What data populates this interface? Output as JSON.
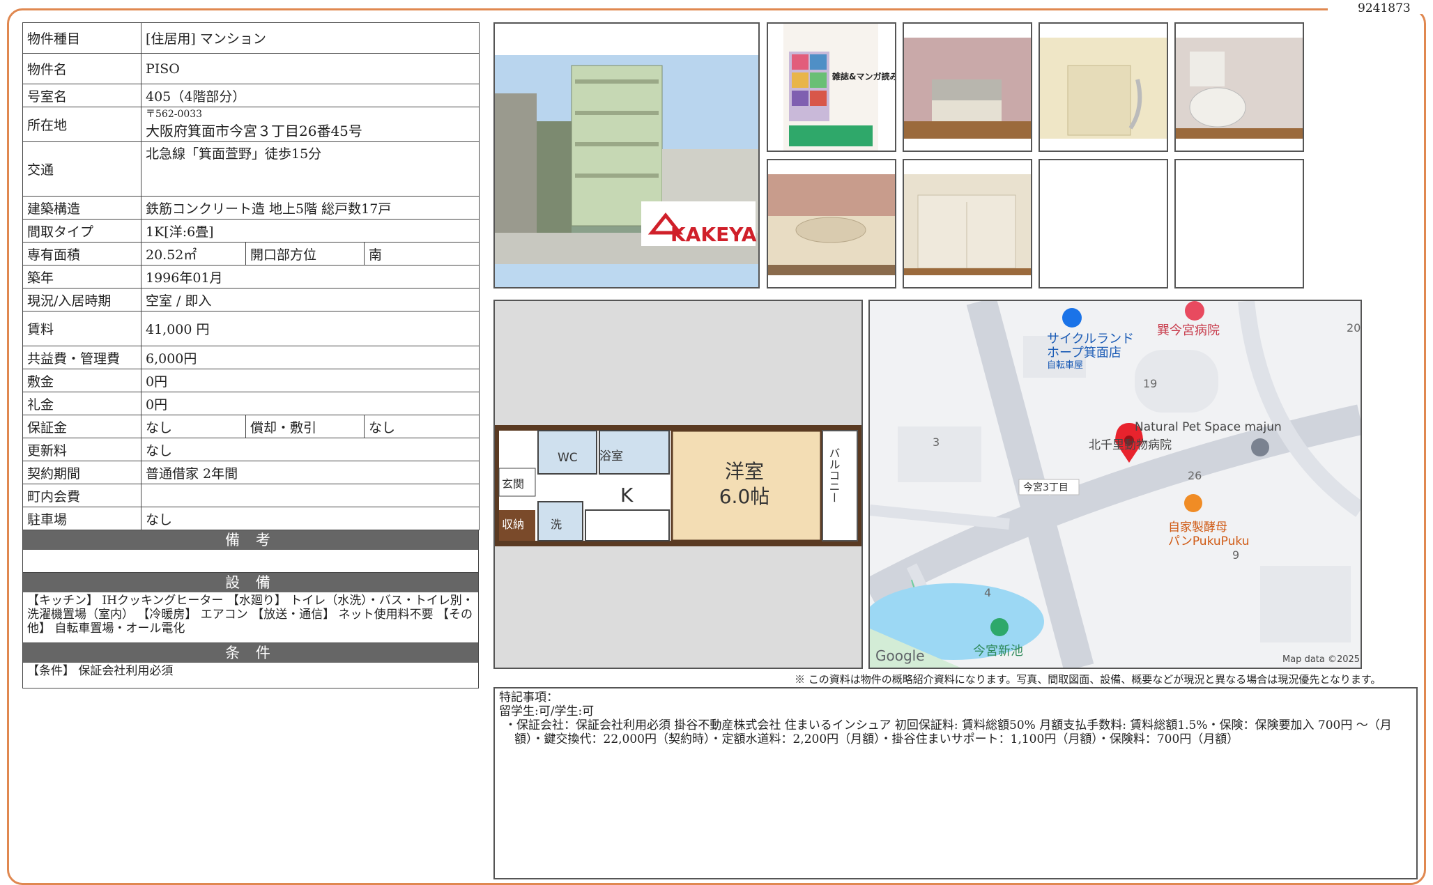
{
  "doc_id": "9241873",
  "property": {
    "type_label": "物件種目",
    "type_value": "[住居用] マンション",
    "name_label": "物件名",
    "name_value": "PISO",
    "room_label": "号室名",
    "room_value": "405（4階部分）",
    "address_label": "所在地",
    "postal": "〒562-0033",
    "address_value": "大阪府箕面市今宮３丁目26番45号",
    "transit_label": "交通",
    "transit_value": "北急線「箕面萱野」徒歩15分",
    "structure_label": "建築構造",
    "structure_value": "鉄筋コンクリート造 地上5階 総戸数17戸",
    "layout_label": "間取タイプ",
    "layout_value": "1K[洋:6畳]",
    "area_label": "専有面積",
    "area_value": "20.52㎡",
    "direction_label": "開口部方位",
    "direction_value": "南",
    "built_label": "築年",
    "built_value": "1996年01月",
    "status_label": "現況/入居時期",
    "status_value": "空室 / 即入",
    "rent_label": "賃料",
    "rent_value": "41,000 円",
    "fee_label": "共益費・管理費",
    "fee_value": "6,000円",
    "deposit_label": "敷金",
    "deposit_value": "0円",
    "key_money_label": "礼金",
    "key_money_value": "0円",
    "guarantee_label": "保証金",
    "guarantee_value": "なし",
    "amortization_label": "償却・敷引",
    "amortization_value": "なし",
    "renewal_label": "更新料",
    "renewal_value": "なし",
    "contract_label": "契約期間",
    "contract_value": "普通借家 2年間",
    "association_label": "町内会費",
    "association_value": "",
    "parking_label": "駐車場",
    "parking_value": "なし"
  },
  "sections": {
    "remarks_title": "備 考",
    "remarks_body": "",
    "equipment_title": "設 備",
    "equipment_body": "【キッチン】 IHクッキングヒーター 【水廻り】 トイレ（水洗）・バス・トイレ別・洗濯機置場（室内） 【冷暖房】 エアコン 【放送・通信】 ネット使用料不要 【その他】 自転車置場・オール電化",
    "conditions_title": "条 件",
    "conditions_body": "【条件】 保証会社利用必須"
  },
  "photos": {
    "logo_text": "KAKEYA",
    "flyer_title": "雑誌&マンガ読み放題"
  },
  "floor_plan": {
    "room_label": "洋室",
    "room_size": "6.0帖",
    "kitchen": "K",
    "bath": "浴室",
    "wc": "WC",
    "entrance": "玄関",
    "storage": "収納",
    "laundry": "洗",
    "balcony": "バルコニー"
  },
  "map": {
    "shop1": "サイクルランド",
    "shop1b": "ホープ箕面店",
    "shop1c": "自転車屋",
    "hospital": "巽今宮病院",
    "pet_space": "Natural Pet Space majun",
    "animal_hospital": "北千里動物病院",
    "bakery1": "自家製酵母",
    "bakery2": "パンPukuPuku",
    "pond": "今宮新池",
    "district": "今宮3丁目",
    "n20": "20",
    "n19": "19",
    "n3": "3",
    "n26": "26",
    "n9": "9",
    "n4": "4",
    "google": "Google",
    "attribution": "Map data ©2025"
  },
  "notice": "※ この資料は物件の概略紹介資料になります。写真、間取図面、設備、概要などが現況と異なる場合は現況優先となります。",
  "special_notes": {
    "title": "特記事項：",
    "line1": "留学生:可/学生:可",
    "line2": "・保証会社：保証会社利用必須 掛谷不動産株式会社 住まいるインシュア 初回保証料: 賃料総額50% 月額支払手数料: 賃料総額1.5%・保険：保険要加入 700円 〜（月額）・鍵交換代：22,000円（契約時）・定額水道料：2,200円（月額）・掛谷住まいサポート：1,100円（月額）・保険料：700円（月額）"
  }
}
